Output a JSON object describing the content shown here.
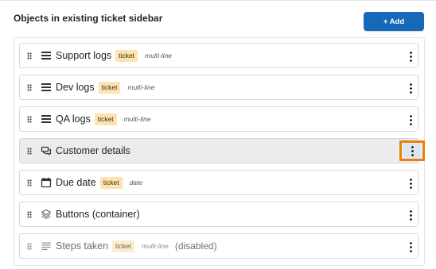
{
  "panel": {
    "title": "Objects in existing ticket sidebar",
    "add_label": "+ Add"
  },
  "colors": {
    "primary": "#1668b8",
    "badge": "#fde3b0",
    "highlight": "#f07d0a",
    "selected_row": "#ececed"
  },
  "items": [
    {
      "label": "Support logs",
      "badge": "ticket",
      "meta": "multi-line",
      "extra": "",
      "icon": "list-icon"
    },
    {
      "label": "Dev logs",
      "badge": "ticket",
      "meta": "multi-line",
      "extra": "",
      "icon": "list-icon"
    },
    {
      "label": "QA logs",
      "badge": "ticket",
      "meta": "multi-line",
      "extra": "",
      "icon": "list-icon"
    },
    {
      "label": "Customer details",
      "badge": "",
      "meta": "",
      "extra": "",
      "icon": "chat-bubbles-icon",
      "selected": true
    },
    {
      "label": "Due date",
      "badge": "ticket",
      "meta": "date",
      "extra": "",
      "icon": "calendar-icon"
    },
    {
      "label": "Buttons (container)",
      "badge": "",
      "meta": "",
      "extra": "",
      "icon": "layers-icon"
    },
    {
      "label": "Steps taken",
      "badge": "ticket",
      "meta": "multi-line",
      "extra": "(disabled)",
      "icon": "text-lines-icon",
      "disabled": true
    }
  ]
}
